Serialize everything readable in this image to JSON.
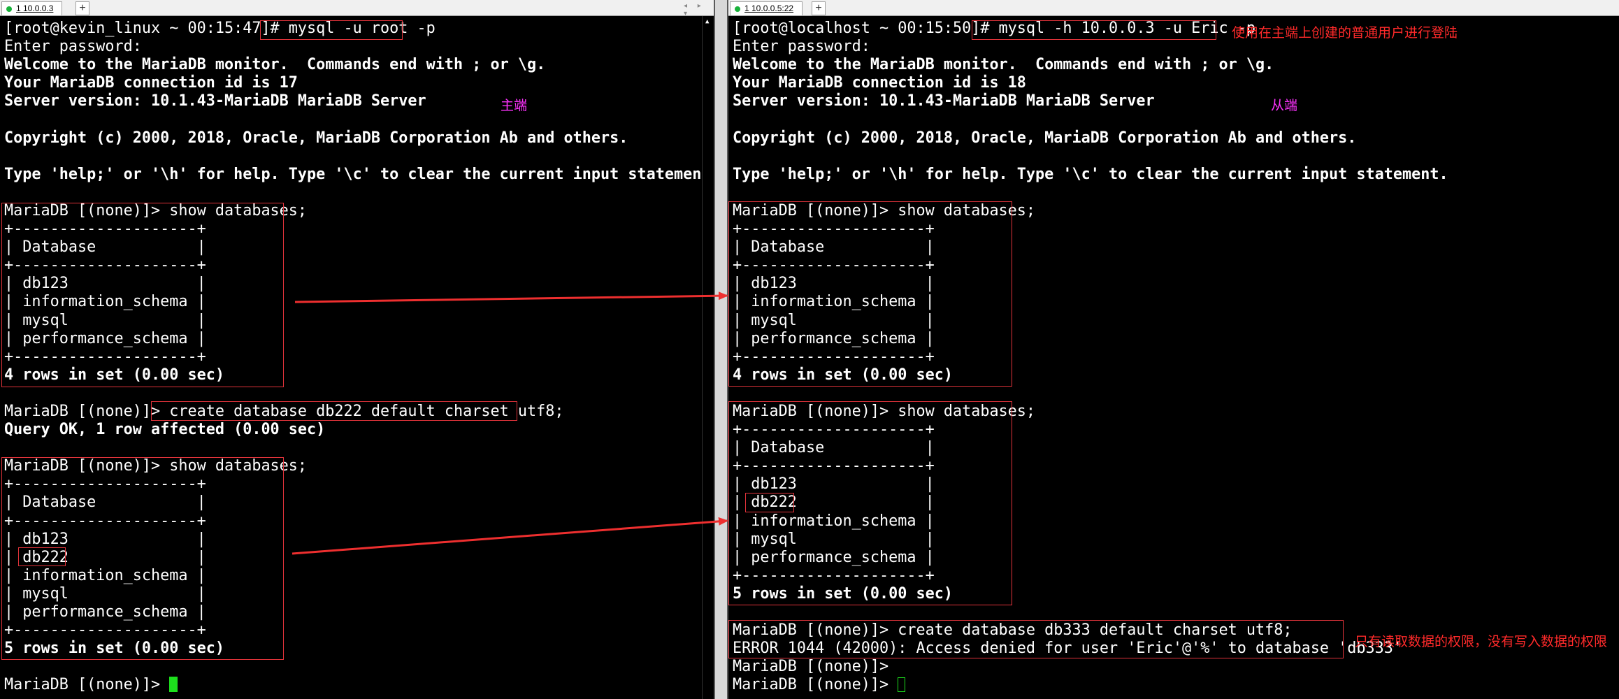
{
  "left_pane": {
    "tab_label": "1 10.0.0.3",
    "new_tab": "+",
    "nav": "◂ ▸ ▾",
    "terminal": [
      {
        "text": "[root@kevin_linux ~ 00:15:47]# mysql -u root -p",
        "bold": false
      },
      {
        "text": "Enter password:",
        "bold": false
      },
      {
        "text": "Welcome to the MariaDB monitor.  Commands end with ; or \\g.",
        "bold": true
      },
      {
        "text": "Your MariaDB connection id is 17",
        "bold": true
      },
      {
        "text": "Server version: 10.1.43-MariaDB MariaDB Server",
        "bold": true
      },
      {
        "text": "",
        "bold": false
      },
      {
        "text": "Copyright (c) 2000, 2018, Oracle, MariaDB Corporation Ab and others.",
        "bold": true
      },
      {
        "text": "",
        "bold": false
      },
      {
        "text": "Type 'help;' or '\\h' for help. Type '\\c' to clear the current input statement.",
        "bold": true
      },
      {
        "text": "",
        "bold": false
      },
      {
        "text": "MariaDB [(none)]> show databases;",
        "bold": false
      },
      {
        "text": "+--------------------+",
        "bold": false
      },
      {
        "text": "| Database           |",
        "bold": false
      },
      {
        "text": "+--------------------+",
        "bold": false
      },
      {
        "text": "| db123              |",
        "bold": false
      },
      {
        "text": "| information_schema |",
        "bold": false
      },
      {
        "text": "| mysql              |",
        "bold": false
      },
      {
        "text": "| performance_schema |",
        "bold": false
      },
      {
        "text": "+--------------------+",
        "bold": false
      },
      {
        "text": "4 rows in set (0.00 sec)",
        "bold": true
      },
      {
        "text": "",
        "bold": false
      },
      {
        "text": "MariaDB [(none)]> create database db222 default charset utf8;",
        "bold": false
      },
      {
        "text": "Query OK, 1 row affected (0.00 sec)",
        "bold": true
      },
      {
        "text": "",
        "bold": false
      },
      {
        "text": "MariaDB [(none)]> show databases;",
        "bold": false
      },
      {
        "text": "+--------------------+",
        "bold": false
      },
      {
        "text": "| Database           |",
        "bold": false
      },
      {
        "text": "+--------------------+",
        "bold": false
      },
      {
        "text": "| db123              |",
        "bold": false
      },
      {
        "text": "| db222              |",
        "bold": false
      },
      {
        "text": "| information_schema |",
        "bold": false
      },
      {
        "text": "| mysql              |",
        "bold": false
      },
      {
        "text": "| performance_schema |",
        "bold": false
      },
      {
        "text": "+--------------------+",
        "bold": false
      },
      {
        "text": "5 rows in set (0.00 sec)",
        "bold": true
      },
      {
        "text": "",
        "bold": false
      },
      {
        "text": "MariaDB [(none)]> ",
        "bold": false,
        "cursor": "filled"
      }
    ],
    "annotation": "主端"
  },
  "right_pane": {
    "tab_label": "1 10.0.0.5:22",
    "new_tab": "+",
    "terminal": [
      {
        "text": "[root@localhost ~ 00:15:50]# mysql -h 10.0.0.3 -u Eric -p",
        "bold": false
      },
      {
        "text": "Enter password:",
        "bold": false
      },
      {
        "text": "Welcome to the MariaDB monitor.  Commands end with ; or \\g.",
        "bold": true
      },
      {
        "text": "Your MariaDB connection id is 18",
        "bold": true
      },
      {
        "text": "Server version: 10.1.43-MariaDB MariaDB Server",
        "bold": true
      },
      {
        "text": "",
        "bold": false
      },
      {
        "text": "Copyright (c) 2000, 2018, Oracle, MariaDB Corporation Ab and others.",
        "bold": true
      },
      {
        "text": "",
        "bold": false
      },
      {
        "text": "Type 'help;' or '\\h' for help. Type '\\c' to clear the current input statement.",
        "bold": true
      },
      {
        "text": "",
        "bold": false
      },
      {
        "text": "MariaDB [(none)]> show databases;",
        "bold": false
      },
      {
        "text": "+--------------------+",
        "bold": false
      },
      {
        "text": "| Database           |",
        "bold": false
      },
      {
        "text": "+--------------------+",
        "bold": false
      },
      {
        "text": "| db123              |",
        "bold": false
      },
      {
        "text": "| information_schema |",
        "bold": false
      },
      {
        "text": "| mysql              |",
        "bold": false
      },
      {
        "text": "| performance_schema |",
        "bold": false
      },
      {
        "text": "+--------------------+",
        "bold": false
      },
      {
        "text": "4 rows in set (0.00 sec)",
        "bold": true
      },
      {
        "text": "",
        "bold": false
      },
      {
        "text": "MariaDB [(none)]> show databases;",
        "bold": false
      },
      {
        "text": "+--------------------+",
        "bold": false
      },
      {
        "text": "| Database           |",
        "bold": false
      },
      {
        "text": "+--------------------+",
        "bold": false
      },
      {
        "text": "| db123              |",
        "bold": false
      },
      {
        "text": "| db222              |",
        "bold": false
      },
      {
        "text": "| information_schema |",
        "bold": false
      },
      {
        "text": "| mysql              |",
        "bold": false
      },
      {
        "text": "| performance_schema |",
        "bold": false
      },
      {
        "text": "+--------------------+",
        "bold": false
      },
      {
        "text": "5 rows in set (0.00 sec)",
        "bold": true
      },
      {
        "text": "",
        "bold": false
      },
      {
        "text": "MariaDB [(none)]> create database db333 default charset utf8;",
        "bold": false
      },
      {
        "text": "ERROR 1044 (42000): Access denied for user 'Eric'@'%' to database 'db333'",
        "bold": false
      },
      {
        "text": "MariaDB [(none)]> ",
        "bold": false
      },
      {
        "text": "MariaDB [(none)]> ",
        "bold": false,
        "cursor": "hollow"
      }
    ],
    "annotation_login": "使用在主端上创建的普通用户进行登陆",
    "annotation_role": "从端",
    "annotation_error": "只有读取数据的权限，没有写入数据的权限"
  },
  "colors": {
    "background": "#000000",
    "text": "#ffffff",
    "highlight_box": "#e0333a",
    "arrow": "#ee2f2f",
    "annotation_red": "#ff2a2a",
    "annotation_magenta": "#ff33ff",
    "cursor": "#1de01d",
    "tab_status": "#19b23b"
  }
}
